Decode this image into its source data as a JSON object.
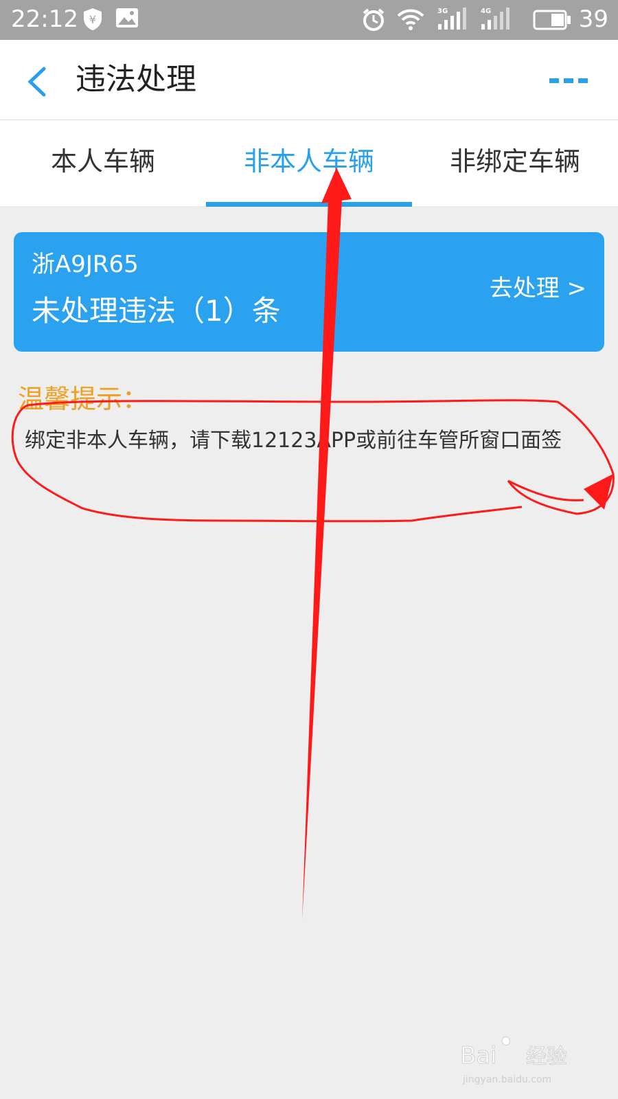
{
  "statusbar": {
    "time": "22:12",
    "net_3g": "3G",
    "net_4g": "4G",
    "battery": "39"
  },
  "header": {
    "title": "违法处理",
    "back_icon": "back-chevron-icon",
    "more_icon": "more-dots-icon"
  },
  "tabs": [
    {
      "label": "本人车辆",
      "active": false
    },
    {
      "label": "非本人车辆",
      "active": true
    },
    {
      "label": "非绑定车辆",
      "active": false
    }
  ],
  "card": {
    "plate": "浙A9JR65",
    "violation": "未处理违法（1）条",
    "action": "去处理 >"
  },
  "tip": {
    "title": "温馨提示：",
    "text": "绑定非本人车辆，请下载12123APP或前往车管所窗口面签"
  },
  "watermark": {
    "brand": "Bai",
    "brand2": "经验",
    "url": "jingyan.baidu.com"
  },
  "colors": {
    "accent": "#29a1ea",
    "card": "#2aa2f0",
    "tip": "#f0a020",
    "annotation": "#ff1a1a",
    "statusbar": "#a3a3a3"
  }
}
